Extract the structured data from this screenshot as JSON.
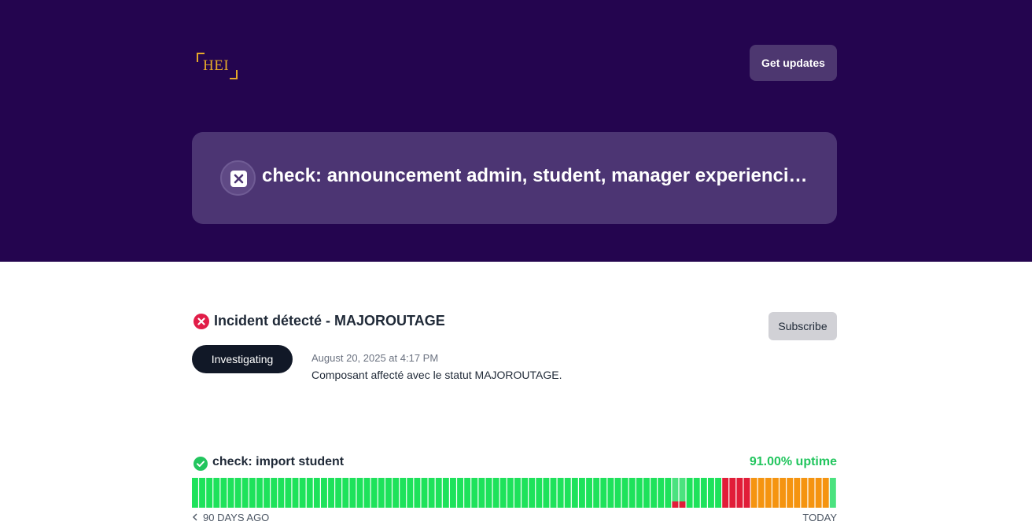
{
  "header": {
    "logo_text": "HEI",
    "get_updates_label": "Get updates"
  },
  "banner": {
    "title": "check: announcement admin, student, manager experiencing ...",
    "icon": "x-square-icon"
  },
  "incident": {
    "icon": "x-circle-icon",
    "title": "Incident détecté - MAJOROUTAGE",
    "subscribe_label": "Subscribe",
    "status": "Investigating",
    "date": "August 20, 2025 at 4:17 PM",
    "body": "Composant affecté avec le statut MAJOROUTAGE."
  },
  "component": {
    "icon": "check-circle-icon",
    "name": "check: import student",
    "uptime_label": "91.00% uptime",
    "range_start_label": "90 DAYS AGO",
    "range_end_label": "TODAY",
    "days": [
      "ok",
      "ok",
      "ok",
      "ok",
      "ok",
      "ok",
      "ok",
      "ok",
      "ok",
      "ok",
      "ok",
      "ok",
      "ok",
      "ok",
      "ok",
      "ok",
      "ok",
      "ok",
      "ok",
      "ok",
      "ok",
      "ok",
      "ok",
      "ok",
      "ok",
      "ok",
      "ok",
      "ok",
      "ok",
      "ok",
      "ok",
      "ok",
      "ok",
      "ok",
      "ok",
      "ok",
      "ok",
      "ok",
      "ok",
      "ok",
      "ok",
      "ok",
      "ok",
      "ok",
      "ok",
      "ok",
      "ok",
      "ok",
      "ok",
      "ok",
      "ok",
      "ok",
      "ok",
      "ok",
      "ok",
      "ok",
      "ok",
      "ok",
      "ok",
      "ok",
      "ok",
      "ok",
      "ok",
      "ok",
      "ok",
      "ok",
      "ok",
      "partial-major",
      "partial-major",
      "ok",
      "ok",
      "ok",
      "ok",
      "ok",
      "major",
      "major",
      "major",
      "major",
      "partial",
      "partial",
      "partial",
      "partial",
      "partial",
      "partial",
      "partial",
      "partial",
      "partial",
      "partial",
      "partial",
      "partial-ok"
    ]
  },
  "colors": {
    "hero_bg": "#24054f",
    "banner_bg": "#4c3573",
    "ok": "#1ee25b",
    "ok_light": "#4be27f",
    "major": "#e11d38",
    "partial": "#f59410",
    "uptime_text": "#22c55e"
  }
}
